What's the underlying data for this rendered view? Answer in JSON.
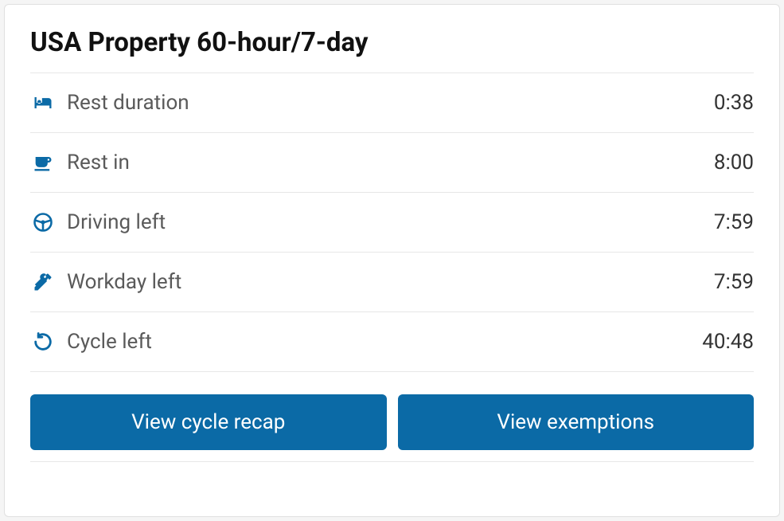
{
  "title": "USA Property 60-hour/7-day",
  "rows": [
    {
      "icon": "bed-icon",
      "label": "Rest duration",
      "value": "0:38"
    },
    {
      "icon": "coffee-icon",
      "label": "Rest in",
      "value": "8:00"
    },
    {
      "icon": "steering-wheel-icon",
      "label": "Driving left",
      "value": "7:59"
    },
    {
      "icon": "tools-icon",
      "label": "Workday left",
      "value": "7:59"
    },
    {
      "icon": "cycle-icon",
      "label": "Cycle left",
      "value": "40:48"
    }
  ],
  "buttons": {
    "recap": "View cycle recap",
    "exemptions": "View exemptions"
  },
  "colors": {
    "accent": "#0b6aa6",
    "text_label": "#5a5a5a",
    "text_value": "#333333"
  }
}
